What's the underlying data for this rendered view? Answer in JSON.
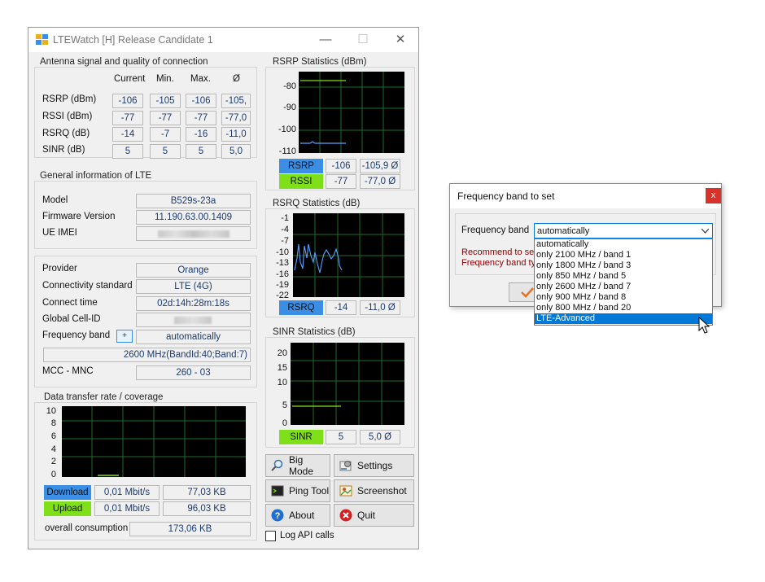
{
  "window": {
    "title": "LTEWatch [H]",
    "subtitle": "Release Candidate 1",
    "minimize": "—",
    "maximize": "☐",
    "close": "✕"
  },
  "antenna": {
    "title": "Antenna signal and quality of connection",
    "headers": [
      "Current",
      "Min.",
      "Max.",
      "Ø"
    ],
    "rows": [
      {
        "label": "RSRP (dBm)",
        "current": "-106",
        "min": "-105",
        "max": "-106",
        "avg": "-105,"
      },
      {
        "label": "RSSI (dBm)",
        "current": "-77",
        "min": "-77",
        "max": "-77",
        "avg": "-77,0"
      },
      {
        "label": "RSRQ (dB)",
        "current": "-14",
        "min": "-7",
        "max": "-16",
        "avg": "-11,0"
      },
      {
        "label": "SINR (dB)",
        "current": "5",
        "min": "5",
        "max": "5",
        "avg": "5,0"
      }
    ]
  },
  "general": {
    "title": "General information of LTE",
    "model_label": "Model",
    "model": "B529s-23a",
    "firmware_label": "Firmware Version",
    "firmware": "11.190.63.00.1409",
    "imei_label": "UE IMEI",
    "imei": "",
    "provider_label": "Provider",
    "provider": "Orange",
    "standard_label": "Connectivity standard",
    "standard": "LTE (4G)",
    "connect_label": "Connect time",
    "connect": "02d:14h:28m:18s",
    "cell_label": "Global Cell-ID",
    "cell": "",
    "band_label": "Frequency band",
    "band_btn": "+",
    "band": "automatically",
    "band_detail": "2600 MHz(BandId:40;Band:7)",
    "mcc_label": "MCC - MNC",
    "mcc": "260 - 03"
  },
  "transfer": {
    "title": "Data transfer rate / coverage",
    "y_ticks": [
      "10",
      "8",
      "6",
      "4",
      "2",
      "0"
    ],
    "download_label": "Download",
    "download_rate": "0,01 Mbit/s",
    "download_total": "77,03 KB",
    "upload_label": "Upload",
    "upload_rate": "0,01 Mbit/s",
    "upload_total": "96,03 KB",
    "overall_label": "overall consumption",
    "overall": "173,06 KB",
    "download_color": "#3a8ee6",
    "upload_color": "#7fe01a"
  },
  "rsrp": {
    "title": "RSRP Statistics (dBm)",
    "y_ticks": [
      "-80",
      "-90",
      "-100",
      "-110"
    ],
    "rsrp_label": "RSRP",
    "rsrp_cur": "-106",
    "rsrp_avg": "-105,9 Ø",
    "rssi_label": "RSSI",
    "rssi_cur": "-77",
    "rssi_avg": "-77,0 Ø"
  },
  "rsrq": {
    "title": "RSRQ Statistics (dB)",
    "y_ticks": [
      "-1",
      "-4",
      "-7",
      "-10",
      "-13",
      "-16",
      "-19",
      "-22"
    ],
    "label": "RSRQ",
    "cur": "-14",
    "avg": "-11,0 Ø"
  },
  "sinr": {
    "title": "SINR Statistics (dB)",
    "y_ticks": [
      "20",
      "15",
      "10",
      "5",
      "0"
    ],
    "label": "SINR",
    "cur": "5",
    "avg": "5,0 Ø"
  },
  "buttons": {
    "big_mode": "Big Mode",
    "settings": "Settings",
    "ping_tool": "Ping Tool",
    "screenshot": "Screenshot",
    "about": "About",
    "quit": "Quit",
    "log_api": "Log API calls"
  },
  "dialog": {
    "title": "Frequency band to set",
    "close": "x",
    "band_label": "Frequency band",
    "selected": "automatically",
    "recommend_1": "Recommend to sel",
    "recommend_2": "Frequency band typ",
    "options": [
      "automatically",
      "only 2100 MHz / band 1",
      "only 1800 MHz / band 3",
      "only 850 MHz / band 5",
      "only 2600 MHz / band 7",
      "only 900 MHz / band 8",
      "only 800 MHz / band 20",
      "LTE-Advanced"
    ],
    "highlighted_option": "LTE-Advanced"
  },
  "colors": {
    "accent_blue": "#3a8ee6",
    "accent_green": "#7fe01a",
    "value_text": "#1c3a6e",
    "recommend_text": "#8b0000"
  }
}
